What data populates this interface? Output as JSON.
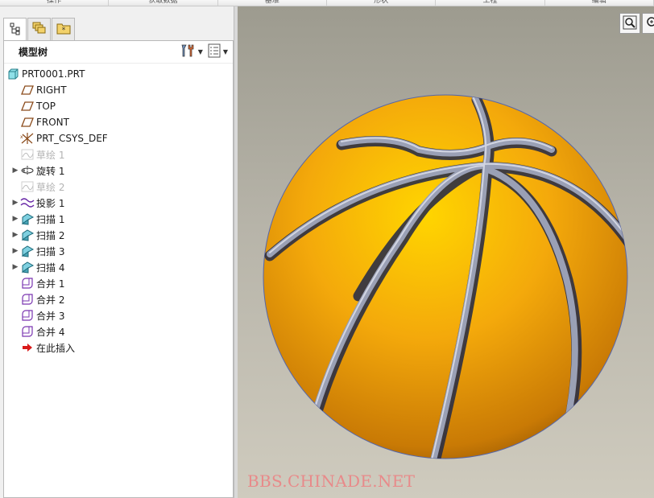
{
  "ribbon": {
    "items": [
      "操作",
      "获取数据",
      "基准",
      "形状",
      "工程",
      "编辑"
    ]
  },
  "tabs": [
    {
      "icon": "model-tree-icon"
    },
    {
      "icon": "layers-icon"
    },
    {
      "icon": "favorites-icon"
    }
  ],
  "model_tree": {
    "title": "模型树",
    "settings_icon": "tree-settings-icon",
    "columns_icon": "tree-columns-icon",
    "items": [
      {
        "label": "PRT0001.PRT",
        "icon": "part-icon",
        "level": 0,
        "expandable": false,
        "dim": false
      },
      {
        "label": "RIGHT",
        "icon": "datum-plane-icon",
        "level": 1,
        "expandable": false,
        "dim": false
      },
      {
        "label": "TOP",
        "icon": "datum-plane-icon",
        "level": 1,
        "expandable": false,
        "dim": false
      },
      {
        "label": "FRONT",
        "icon": "datum-plane-icon",
        "level": 1,
        "expandable": false,
        "dim": false
      },
      {
        "label": "PRT_CSYS_DEF",
        "icon": "csys-icon",
        "level": 1,
        "expandable": false,
        "dim": false
      },
      {
        "label": "草绘 1",
        "icon": "sketch-icon",
        "level": 1,
        "expandable": false,
        "dim": true
      },
      {
        "label": "旋转 1",
        "icon": "revolve-icon",
        "level": 1,
        "expandable": true,
        "dim": false
      },
      {
        "label": "草绘 2",
        "icon": "sketch-icon",
        "level": 1,
        "expandable": false,
        "dim": true
      },
      {
        "label": "投影 1",
        "icon": "projection-icon",
        "level": 1,
        "expandable": true,
        "dim": false
      },
      {
        "label": "扫描 1",
        "icon": "sweep-icon",
        "level": 1,
        "expandable": true,
        "dim": false
      },
      {
        "label": "扫描 2",
        "icon": "sweep-icon",
        "level": 1,
        "expandable": true,
        "dim": false
      },
      {
        "label": "扫描 3",
        "icon": "sweep-icon",
        "level": 1,
        "expandable": true,
        "dim": false
      },
      {
        "label": "扫描 4",
        "icon": "sweep-icon",
        "level": 1,
        "expandable": true,
        "dim": false
      },
      {
        "label": "合并 1",
        "icon": "merge-icon",
        "level": 1,
        "expandable": false,
        "dim": false
      },
      {
        "label": "合并 2",
        "icon": "merge-icon",
        "level": 1,
        "expandable": false,
        "dim": false
      },
      {
        "label": "合并 3",
        "icon": "merge-icon",
        "level": 1,
        "expandable": false,
        "dim": false
      },
      {
        "label": "合并 4",
        "icon": "merge-icon",
        "level": 1,
        "expandable": false,
        "dim": false
      },
      {
        "label": "在此插入",
        "icon": "insert-here-arrow-icon",
        "level": 1,
        "expandable": false,
        "dim": false
      }
    ]
  },
  "viewport": {
    "tools": [
      "zoom-fit-icon",
      "zoom-in-icon"
    ],
    "model": "basketball-model",
    "watermark": "BBS.CHINADE.NET",
    "colors": {
      "ball": "#f2a60c",
      "seam": "#8f94a8",
      "background": "#b7b4a9"
    }
  }
}
